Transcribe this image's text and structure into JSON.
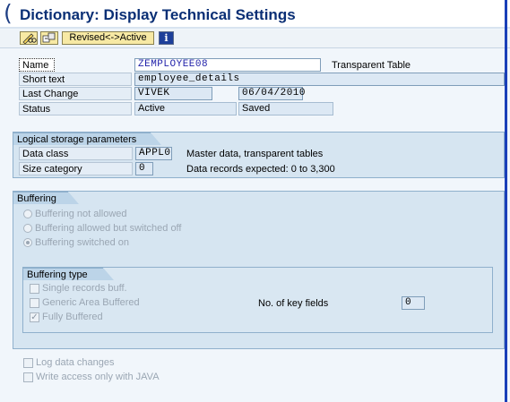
{
  "window": {
    "title": "Dictionary: Display Technical Settings",
    "title_prefix": "("
  },
  "toolbar": {
    "edit_icon": "pencil-glasses-icon",
    "toggle_icon": "display-change-icon",
    "revised_active_label": "Revised<->Active",
    "info_icon": "info-icon",
    "info_glyph": "i"
  },
  "header": {
    "name_label": "Name",
    "name_value": "ZEMPLOYEE08",
    "table_type": "Transparent Table",
    "short_text_label": "Short text",
    "short_text_value": "employee_details",
    "last_change_label": "Last Change",
    "last_change_user": "VIVEK",
    "last_change_date": "06/04/2010",
    "status_label": "Status",
    "status_value": "Active",
    "status_saved": "Saved"
  },
  "storage": {
    "title": "Logical storage parameters",
    "data_class_label": "Data class",
    "data_class_value": "APPL0",
    "data_class_desc": "Master data, transparent tables",
    "size_category_label": "Size category",
    "size_category_value": "0",
    "size_category_desc": "Data records expected: 0 to 3,300"
  },
  "buffering": {
    "title": "Buffering",
    "options": [
      {
        "label": "Buffering not allowed",
        "selected": false
      },
      {
        "label": "Buffering allowed but switched off",
        "selected": false
      },
      {
        "label": "Buffering switched on",
        "selected": true
      }
    ],
    "type_title": "Buffering type",
    "types": [
      {
        "label": "Single records buff.",
        "checked": false
      },
      {
        "label": "Generic Area Buffered",
        "checked": false
      },
      {
        "label": "Fully Buffered",
        "checked": true
      }
    ],
    "key_fields_label": "No. of key fields",
    "key_fields_value": "0"
  },
  "footer": {
    "log_changes_label": "Log data changes",
    "log_changes_checked": false,
    "java_write_label": "Write access only with JAVA",
    "java_write_checked": false
  },
  "colors": {
    "title": "#0a2f75",
    "button_yellow": "#f7e9a4",
    "group_bg": "#d6e5f1",
    "group_border": "#8fb0cc"
  }
}
